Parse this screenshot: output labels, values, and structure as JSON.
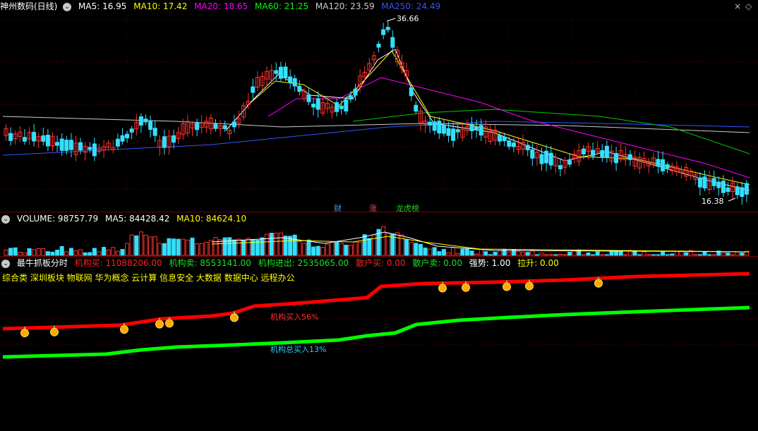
{
  "main": {
    "title": "神州数码(日线)",
    "ma": [
      {
        "label": "MA5: 16.95",
        "color": "#ffffff"
      },
      {
        "label": "MA10: 17.42",
        "color": "#ffff00"
      },
      {
        "label": "MA20: 18.65",
        "color": "#ff00ff"
      },
      {
        "label": "MA60: 21.25",
        "color": "#00ff00"
      },
      {
        "label": "MA120: 23.59",
        "color": "#cccccc"
      },
      {
        "label": "MA250: 24.49",
        "color": "#3355ff"
      }
    ],
    "high_label": "36.66",
    "low_label": "16.38",
    "events": [
      {
        "label": "财",
        "color": "#3aa0ff"
      },
      {
        "label": "涨",
        "color": "#ff4040"
      },
      {
        "label": "龙虎榜",
        "color": "#22cc22"
      }
    ]
  },
  "volume": {
    "labels": [
      {
        "text": "VOLUME: 98757.79",
        "color": "#ffffff"
      },
      {
        "text": "MA5: 84428.42",
        "color": "#ffffff"
      },
      {
        "text": "MA10: 84624.10",
        "color": "#ffff00"
      }
    ]
  },
  "indicator": {
    "name": "最牛抓板分时",
    "values": [
      {
        "text": "机构买: 11088206.00",
        "color": "#ff2020"
      },
      {
        "text": "机构卖: 8553141.00",
        "color": "#22dd22"
      },
      {
        "text": "机构进出: 2535065.00",
        "color": "#22dd22"
      },
      {
        "text": "散户买: 0.00",
        "color": "#ff2020"
      },
      {
        "text": "散户卖: 0.00",
        "color": "#22dd22"
      },
      {
        "text": "强势: 1.00",
        "color": "#ffffff"
      },
      {
        "text": "拉升: 0.00",
        "color": "#ffff00"
      }
    ],
    "sectors": "综合类 深圳板块 物联网 华为概念 云计算 信息安全 大数据 数据中心 远程办公",
    "buy_label": "机构买入56%",
    "total_label": "机构总买入13%"
  },
  "chart_data": {
    "type": "line",
    "price_high": 36.66,
    "price_low": 16.38,
    "buy_line_share_percent": 56,
    "total_line_share_percent": 13
  }
}
